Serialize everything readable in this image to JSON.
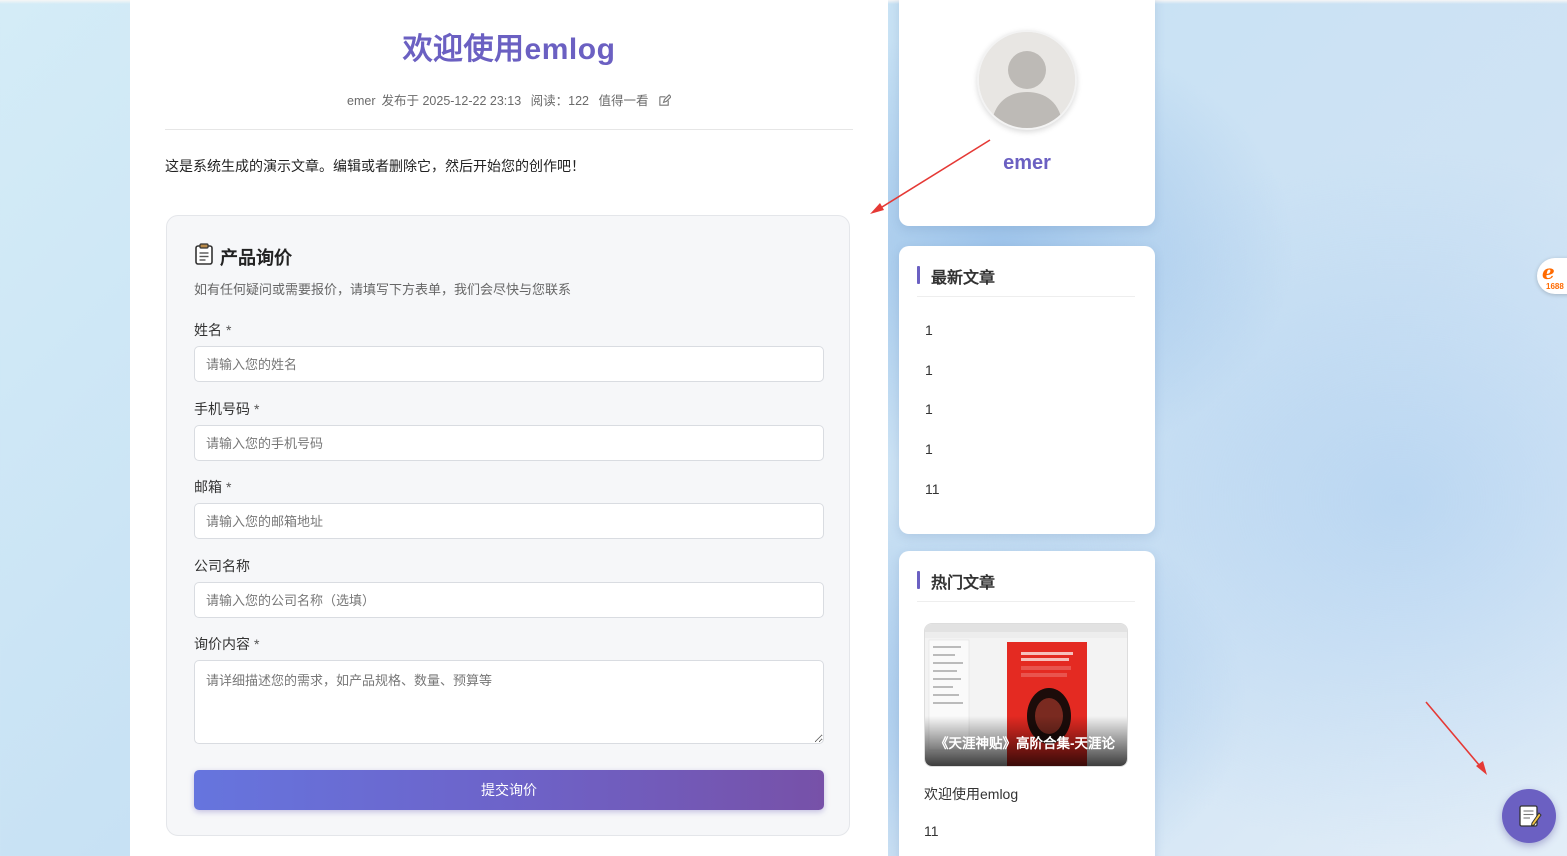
{
  "article": {
    "title": "欢迎使用emlog",
    "meta": {
      "author": "emer",
      "published": "发布于 2025-12-22 23:13",
      "reads": "阅读：122",
      "recommend": "值得一看"
    },
    "intro": "这是系统生成的演示文章。编辑或者删除它，然后开始您的创作吧！"
  },
  "inquiry_form": {
    "title": "产品询价",
    "subtitle": "如有任何疑问或需要报价，请填写下方表单，我们会尽快与您联系",
    "fields": {
      "name": {
        "label": "姓名",
        "required_mark": "*",
        "placeholder": "请输入您的姓名",
        "value": ""
      },
      "phone": {
        "label": "手机号码",
        "required_mark": "*",
        "placeholder": "请输入您的手机号码",
        "value": ""
      },
      "email": {
        "label": "邮箱",
        "required_mark": "*",
        "placeholder": "请输入您的邮箱地址",
        "value": ""
      },
      "company": {
        "label": "公司名称",
        "placeholder": "请输入您的公司名称（选填）",
        "value": ""
      },
      "content": {
        "label": "询价内容",
        "required_mark": "*",
        "placeholder": "请详细描述您的需求，如产品规格、数量、预算等",
        "value": ""
      }
    },
    "submit_label": "提交询价"
  },
  "sidebar": {
    "profile": {
      "name": "emer"
    },
    "latest": {
      "title": "最新文章",
      "items": [
        "1",
        "1",
        "1",
        "1",
        "11"
      ]
    },
    "hot": {
      "title": "热门文章",
      "featured_caption": "《天涯神贴》高阶合集-天涯论",
      "items": [
        "欢迎使用emlog",
        "11"
      ]
    }
  },
  "floating": {
    "badge_1688_text": "1688"
  },
  "colors": {
    "accent": "#6b60c2",
    "button_gradient_start": "#6675de",
    "button_gradient_end": "#7751a8",
    "annotation_arrow": "#e53935"
  }
}
